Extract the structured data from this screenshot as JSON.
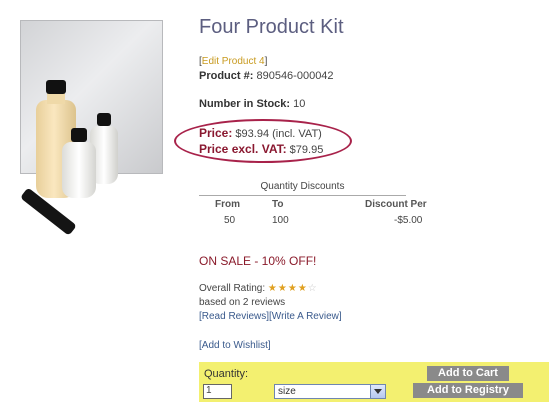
{
  "product": {
    "image_icon": "product-kit-image",
    "title": "Four Product Kit",
    "edit_bracket_open": "[",
    "edit_link": "Edit Product 4",
    "edit_bracket_close": "]",
    "product_num_label": "Product #:",
    "product_num": "890546-000042",
    "stock_label": "Number in Stock:",
    "stock": "10"
  },
  "pricing": {
    "price_label": "Price:",
    "price_value": "$93.94 (incl. VAT)",
    "excl_label": "Price excl. VAT:",
    "excl_value": "$79.95",
    "highlight_color": "#a8224a"
  },
  "quantity_discounts": {
    "title": "Quantity Discounts",
    "headers": [
      "From",
      "To",
      "Discount Per"
    ],
    "rows": [
      [
        "50",
        "100",
        "-$5.00"
      ]
    ]
  },
  "sale": {
    "text": "ON SALE - 10% OFF!",
    "color": "#8a1a2a"
  },
  "rating": {
    "label": "Overall Rating:",
    "stars_filled": "★★★★",
    "stars_empty": "☆",
    "value": 4,
    "max": 5,
    "reviews_count_text": "based on 2 reviews",
    "read_reviews": "[Read Reviews]",
    "write_review": "[Write A Review]"
  },
  "wishlist": {
    "link": "[Add to Wishlist]"
  },
  "cart": {
    "quantity_label": "Quantity:",
    "quantity_value": "1",
    "size_value": "size",
    "add_to_cart": "Add to Cart",
    "add_to_registry": "Add to Registry",
    "bar_color": "#f3f070"
  }
}
